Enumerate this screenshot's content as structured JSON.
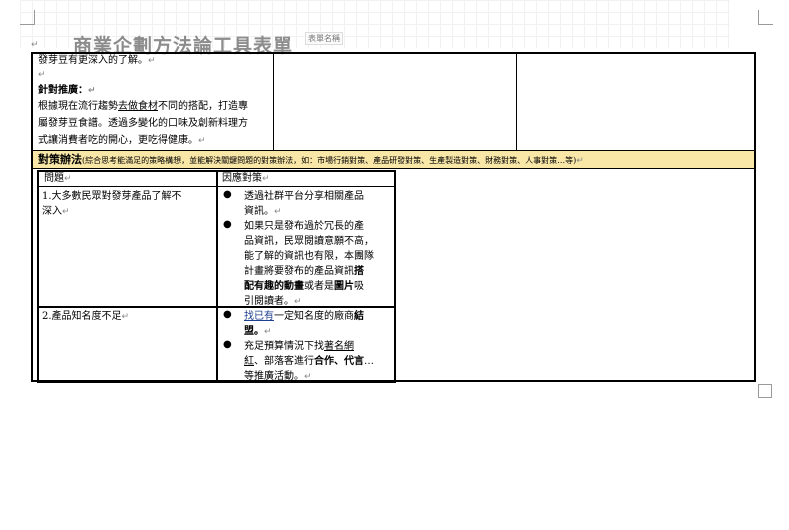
{
  "document": {
    "title": "商業企劃方法論工具表單",
    "title_tag": "表單名稱",
    "para_mark": "↵",
    "intro_line": "發芽豆有更深入的了解。",
    "recommend": {
      "heading": "針對推廣：",
      "line1_a": "根據現在流行趨勢",
      "line1_b": "去做食材",
      "line1_c": "不同的搭配，打造專",
      "line2": "屬發芽豆食譜。透過多變化的口味及創新料理方",
      "line3": "式讓消費者吃的開心，更吃得健康。"
    },
    "strategy_band": {
      "label": "對策辦法",
      "note": "(綜合思考能滿足的策略構想，並能解決關鍵問題的對策辦法，如：市場行銷對策、產品研發對策、生產製造對策、財務對策、人事對策…等)"
    },
    "table": {
      "col_problem": "問題",
      "col_response": "因應對策",
      "rows": [
        {
          "problem_l1": "1.大多數民眾對發芽產品了解不",
          "problem_l2": "深入",
          "b1_l1": "透過社群平台分享相關產品",
          "b1_l2": "資訊。",
          "b2_l1": "如果只是發布過於冗長的產",
          "b2_l2": "品資訊，民眾閱讀意願不高，",
          "b2_l3": "能了解的資訊也有限，本團隊",
          "b2_l4a": "計畫將要發布的產品資訊",
          "b2_l4b": "搭",
          "b2_l5a": "配有趣的動畫",
          "b2_l5b": "或者是",
          "b2_l5c": "圖片",
          "b2_l5d": "吸",
          "b2_l6": "引閱讀者。"
        },
        {
          "problem_l1": "2.產品知名度不足",
          "b1_l1a": "找已有",
          "b1_l1b": "一定知名度的廠商",
          "b1_l1c": "結",
          "b1_l2": "盟。",
          "b2_l1a": "充足預算情況下找",
          "b2_l1b": "著名網",
          "b2_l2a": "紅",
          "b2_l2b": "、部落客進行",
          "b2_l2c": "合作、代言",
          "b2_l2d": "…",
          "b2_l3": "等推廣活動。"
        }
      ]
    }
  }
}
